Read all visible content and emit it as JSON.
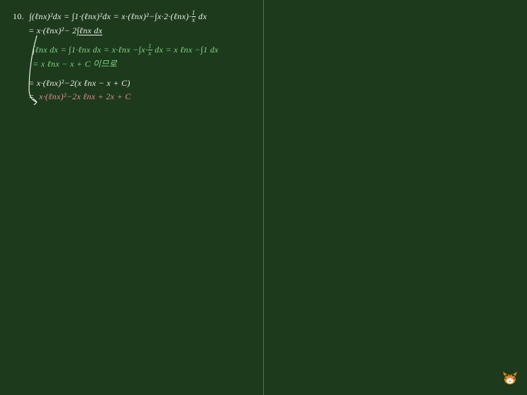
{
  "problem_number": "10.",
  "lines": {
    "l1_before": "∫(ℓnx)²dx = ∫1·(ℓnx)²dx = x·(ℓnx)²−∫x·2·(ℓnx)·",
    "l1_after": " dx",
    "l2_before": "= x·(ℓnx)²− 2",
    "l2_underline": "∫ℓnx dx",
    "l3_before": "∫ℓnx dx = ∫1·ℓnx dx = x·ℓnx −∫x·",
    "l3_after": " dx  = x ℓnx −∫1 dx",
    "l4": "= x ℓnx − x + C 이므로",
    "l5": "= x·(ℓnx)²−2(x ℓnx − x + C)",
    "l6": "=  x·(ℓnx)²−2x ℓnx + 2x + C"
  },
  "frac": {
    "num": "1",
    "den": "x"
  },
  "logo_label": "tiger-logo"
}
